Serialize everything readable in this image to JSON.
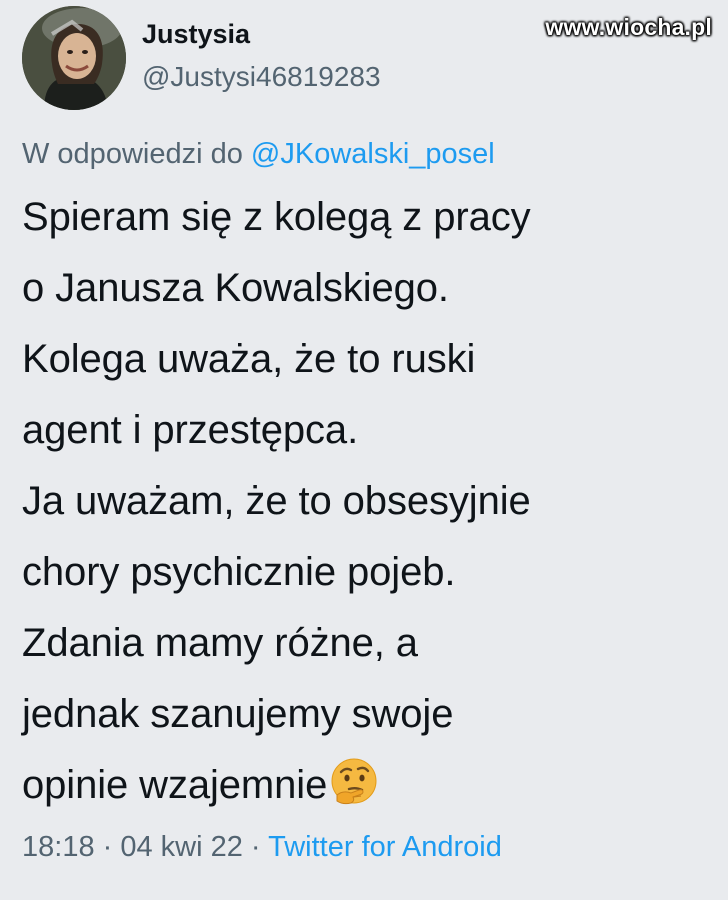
{
  "watermark": "www.wiocha.pl",
  "author": {
    "display_name": "Justysia",
    "handle": "@Justysi46819283"
  },
  "reply": {
    "prefix": "W odpowiedzi do ",
    "target": "@JKowalski_posel"
  },
  "tweet": {
    "lines": [
      "Spieram się z kolegą z pracy",
      "o Janusza Kowalskiego.",
      "Kolega uważa, że to ruski",
      "agent i przestępca.",
      "Ja uważam, że to obsesyjnie",
      "chory psychicznie pojeb.",
      "Zdania mamy różne, a",
      "jednak szanujemy swoje",
      "opinie wzajemnie"
    ],
    "emoji": "thinking-face-icon"
  },
  "meta": {
    "time": "18:18",
    "separator1": " · ",
    "date": "04 kwi 22",
    "separator2": " · ",
    "source": "Twitter for Android"
  },
  "colors": {
    "background": "#e9ebee",
    "text": "#0f1419",
    "secondary": "#536471",
    "link": "#1d9bf0"
  }
}
